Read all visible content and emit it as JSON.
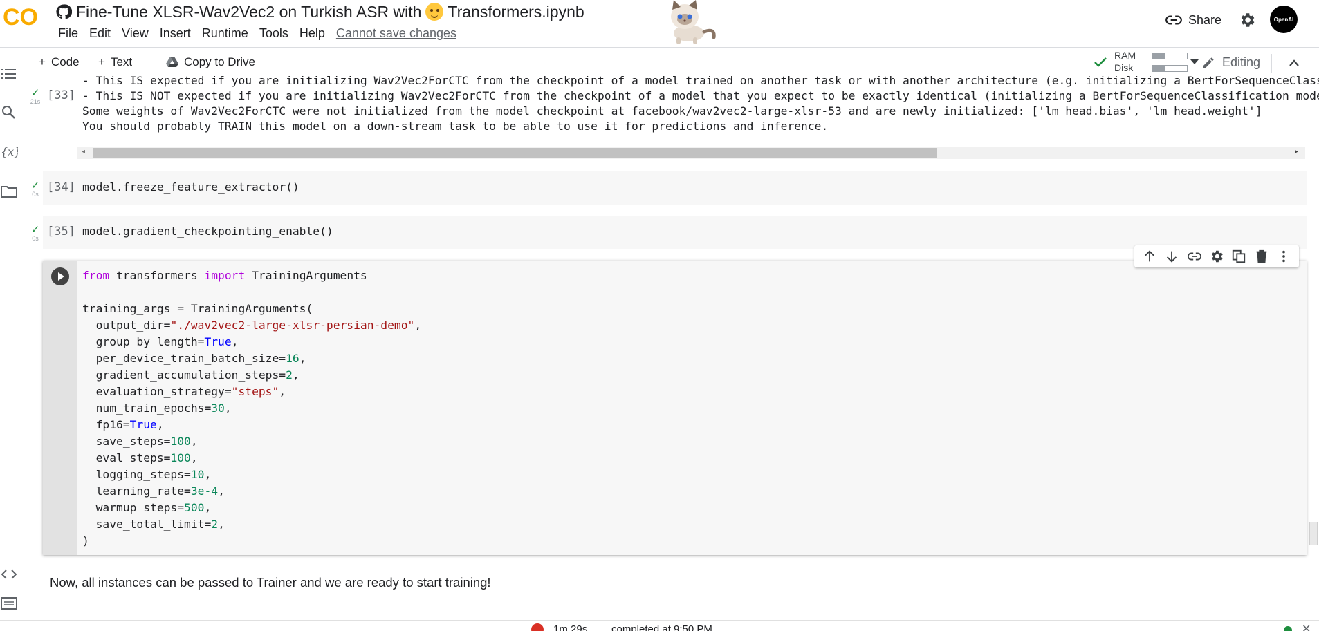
{
  "header": {
    "title": "Fine-Tune XLSR-Wav2Vec2 on Turkish ASR with",
    "title_suffix": "Transformers.ipynb",
    "logo_text": "CO",
    "menu": [
      "File",
      "Edit",
      "View",
      "Insert",
      "Runtime",
      "Tools",
      "Help"
    ],
    "save_status": "Cannot save changes",
    "share_label": "Share",
    "avatar_text": "OpenAI"
  },
  "toolbar": {
    "code_label": "Code",
    "text_label": "Text",
    "copy_label": "Copy to Drive",
    "ram_label": "RAM",
    "disk_label": "Disk",
    "ram_fraction": 0.35,
    "disk_fraction": 0.35,
    "editing_label": "Editing"
  },
  "cells": {
    "c33": {
      "count": "[33]",
      "time": "21s",
      "output": [
        "- This IS expected if you are initializing Wav2Vec2ForCTC from the checkpoint of a model trained on another task or with another architecture (e.g. initializing a BertForSequenceClassi",
        "- This IS NOT expected if you are initializing Wav2Vec2ForCTC from the checkpoint of a model that you expect to be exactly identical (initializing a BertForSequenceClassification model",
        "Some weights of Wav2Vec2ForCTC were not initialized from the model checkpoint at facebook/wav2vec2-large-xlsr-53 and are newly initialized: ['lm_head.bias', 'lm_head.weight']",
        "You should probably TRAIN this model on a down-stream task to be able to use it for predictions and inference."
      ]
    },
    "c34": {
      "count": "[34]",
      "time": "0s",
      "code": "model.freeze_feature_extractor()"
    },
    "c35": {
      "count": "[35]",
      "time": "0s",
      "code": "model.gradient_checkpointing_enable()"
    },
    "active": {
      "l_from": "from",
      "l_mod": " transformers ",
      "l_import": "import",
      "l_name": " TrainingArguments",
      "l_open": "training_args = TrainingArguments(",
      "output_dir_key": "  output_dir=",
      "output_dir_val": "\"./wav2vec2-large-xlsr-persian-demo\"",
      "group_key": "  group_by_length=",
      "group_val": "True",
      "batch_key": "  per_device_train_batch_size=",
      "batch_val": "16",
      "accum_key": "  gradient_accumulation_steps=",
      "accum_val": "2",
      "eval_key": "  evaluation_strategy=",
      "eval_val": "\"steps\"",
      "epochs_key": "  num_train_epochs=",
      "epochs_val": "30",
      "fp16_key": "  fp16=",
      "fp16_val": "True",
      "save_key": "  save_steps=",
      "save_val": "100",
      "evals_key": "  eval_steps=",
      "evals_val": "100",
      "log_key": "  logging_steps=",
      "log_val": "10",
      "lr_key": "  learning_rate=",
      "lr_val": "3e-4",
      "warm_key": "  warmup_steps=",
      "warm_val": "500",
      "limit_key": "  save_total_limit=",
      "limit_val": "2",
      "comma": ",",
      "close": ")"
    }
  },
  "markdown": "Now, all instances can be passed to Trainer and we are ready to start training!",
  "statusbar": {
    "elapsed": "1m 29s",
    "completed": "completed at 9:50 PM"
  },
  "colors": {
    "keyword": "#af00db",
    "string": "#a31515",
    "number": "#098658",
    "boolean": "#0000ff",
    "success": "#1e8e3e",
    "logo_orange": "#f9ab00"
  }
}
